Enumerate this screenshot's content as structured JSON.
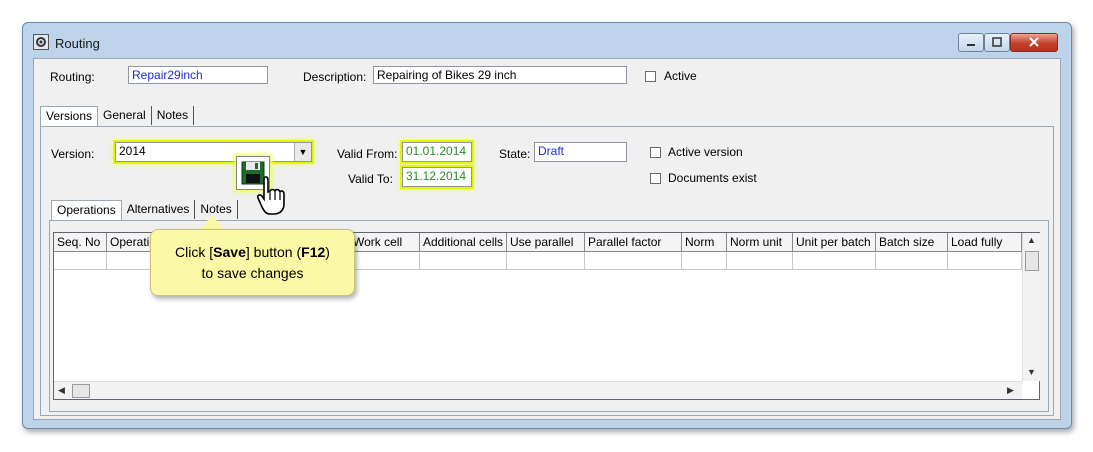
{
  "window": {
    "title": "Routing"
  },
  "header": {
    "routing_label": "Routing:",
    "routing_value": "Repair29inch",
    "description_label": "Description:",
    "description_value": "Repairing of Bikes 29 inch",
    "active_label": "Active"
  },
  "tabs_main": [
    {
      "label": "Versions"
    },
    {
      "label": "General"
    },
    {
      "label": "Notes"
    }
  ],
  "version": {
    "version_label": "Version:",
    "version_value": "2014",
    "valid_from_label": "Valid From:",
    "valid_from_value": "01.01.2014",
    "valid_to_label": "Valid To:",
    "valid_to_value": "31.12.2014",
    "state_label": "State:",
    "state_value": "Draft",
    "active_version_label": "Active version",
    "documents_exist_label": "Documents exist"
  },
  "tabs_sub": [
    {
      "label": "Operations"
    },
    {
      "label": "Alternatives"
    },
    {
      "label": "Notes"
    }
  ],
  "grid": {
    "columns": [
      "Seq. No",
      "Operation",
      "",
      "Work cell",
      "Additional cells",
      "Use parallel",
      "Parallel factor",
      "Norm",
      "Norm unit",
      "Unit per batch",
      "Batch size",
      "Load fully"
    ]
  },
  "callout": {
    "line1_prefix": "Click [",
    "line1_bold": "Save",
    "line1_mid": "] button (",
    "line1_key": "F12",
    "line1_suffix": ")",
    "line2": "to save changes"
  },
  "icons": {
    "save": "floppy-disk-icon",
    "cursor": "hand-pointer-icon"
  },
  "colors": {
    "value_text": "#1b2fd6",
    "highlight": "#e6f500",
    "callout_bg": "#fafaa6",
    "close_button": "#c4412f"
  }
}
